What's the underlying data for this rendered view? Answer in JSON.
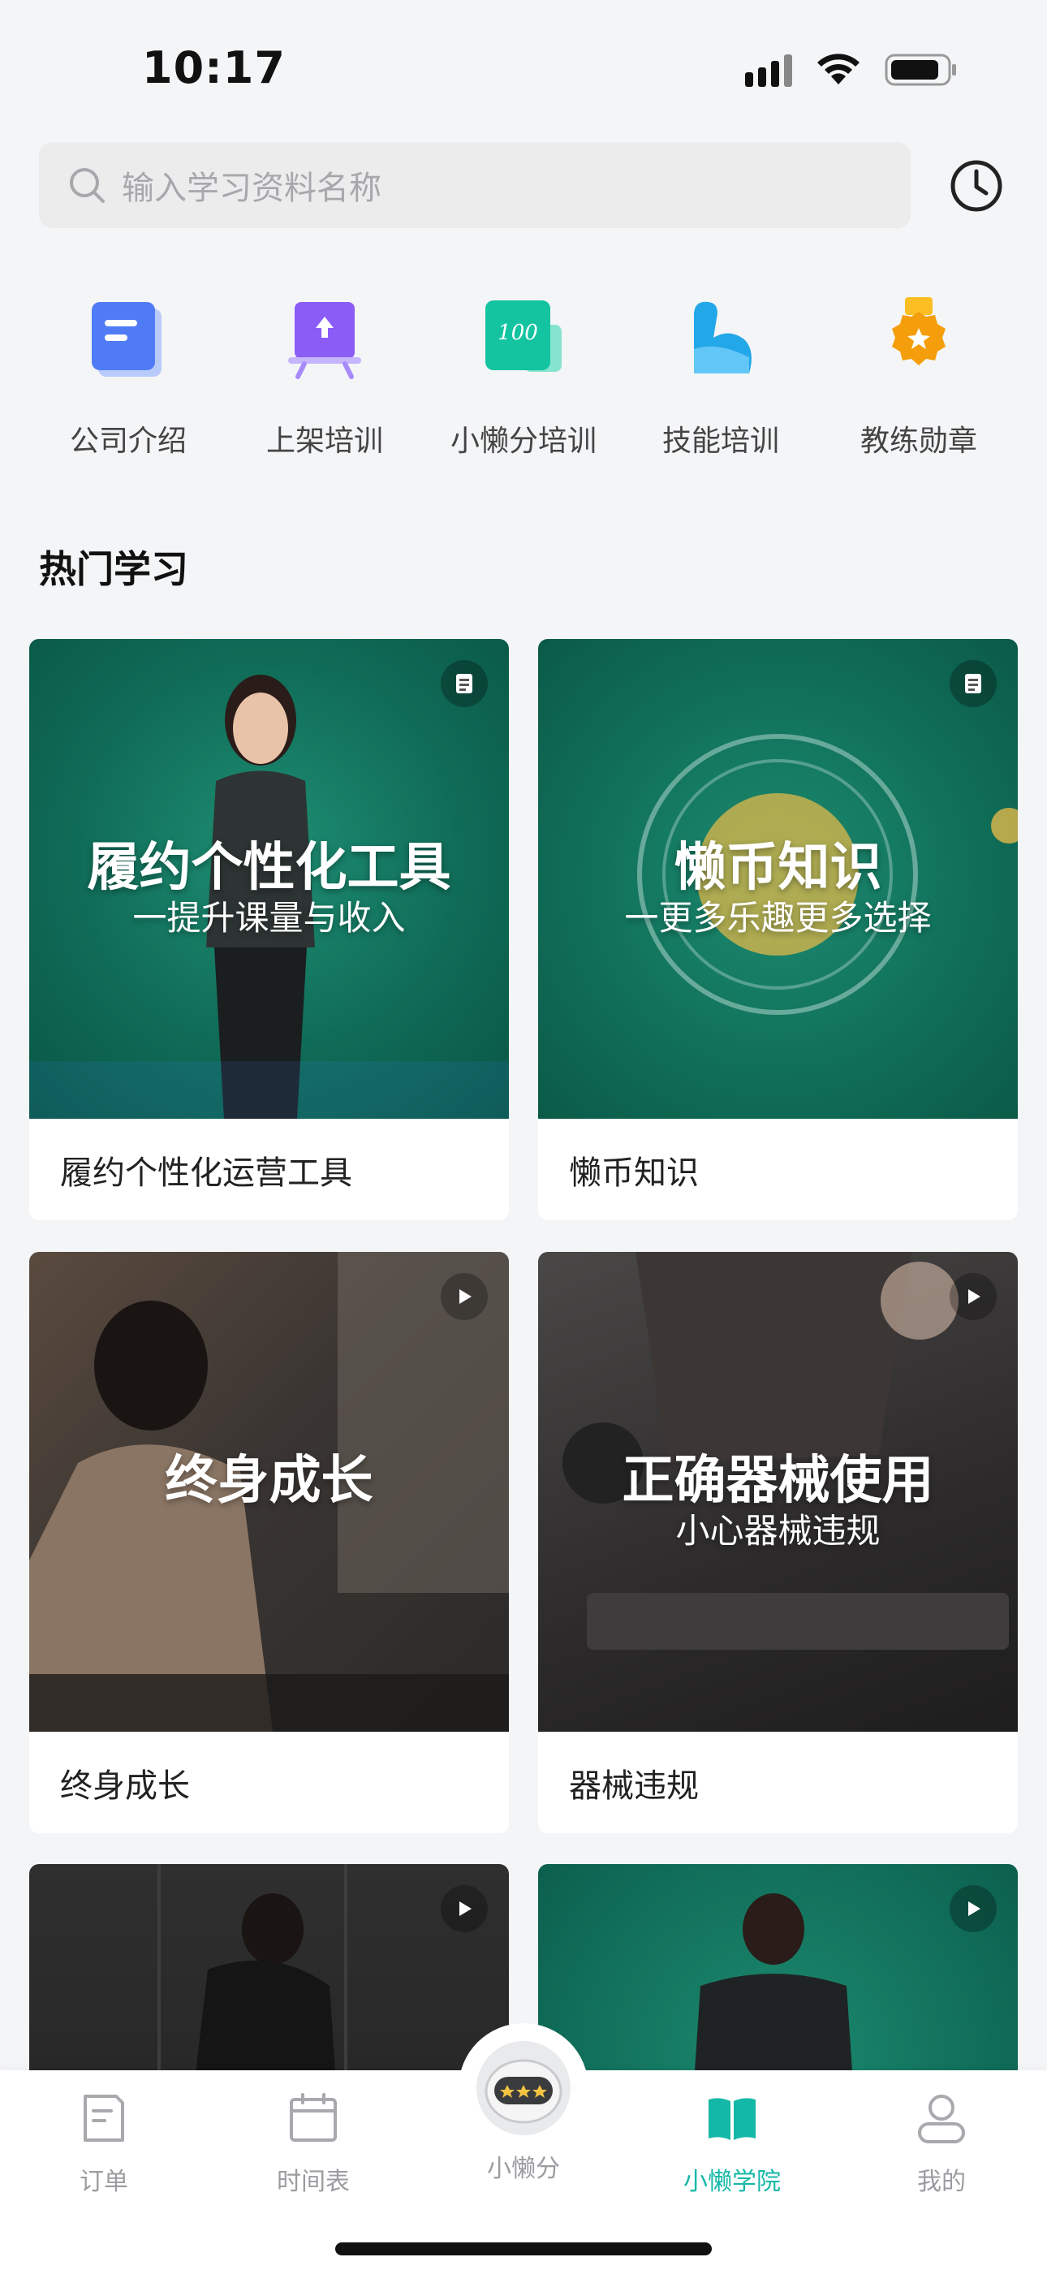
{
  "status": {
    "time": "10:17"
  },
  "search": {
    "placeholder": "输入学习资料名称"
  },
  "categories": [
    {
      "label": "公司介绍",
      "icon": "document-icon",
      "color": "#4f7cf6"
    },
    {
      "label": "上架培训",
      "icon": "easel-icon",
      "color": "#8b5cf6"
    },
    {
      "label": "小懒分培训",
      "icon": "score-100-icon",
      "color": "#14c4a0"
    },
    {
      "label": "技能培训",
      "icon": "muscle-icon",
      "color": "#22a7e8"
    },
    {
      "label": "教练勋章",
      "icon": "medal-icon",
      "color": "#f5a524"
    }
  ],
  "section": {
    "title": "热门学习"
  },
  "cards": [
    {
      "thumb_title": "履约个性化工具",
      "thumb_sub": "一提升课量与收入",
      "caption": "履约个性化运营工具",
      "badge": "document-icon"
    },
    {
      "thumb_title": "懒币知识",
      "thumb_sub": "一更多乐趣更多选择",
      "caption": "懒币知识",
      "badge": "document-icon"
    },
    {
      "thumb_title": "终身成长",
      "thumb_sub": "",
      "caption": "终身成长",
      "badge": "play-icon"
    },
    {
      "thumb_title": "正确器械使用",
      "thumb_sub": "小心器械违规",
      "caption": "器械违规",
      "badge": "play-icon"
    },
    {
      "badge": "play-icon"
    },
    {
      "badge": "play-icon"
    }
  ],
  "tabs": [
    {
      "label": "订单",
      "icon": "order-icon"
    },
    {
      "label": "时间表",
      "icon": "calendar-icon"
    },
    {
      "label": "小懒分",
      "icon": "robot-icon"
    },
    {
      "label": "小懒学院",
      "icon": "book-icon",
      "active": true
    },
    {
      "label": "我的",
      "icon": "person-icon"
    }
  ],
  "colors": {
    "accent": "#14b8a6",
    "card_green": "#117a63"
  }
}
